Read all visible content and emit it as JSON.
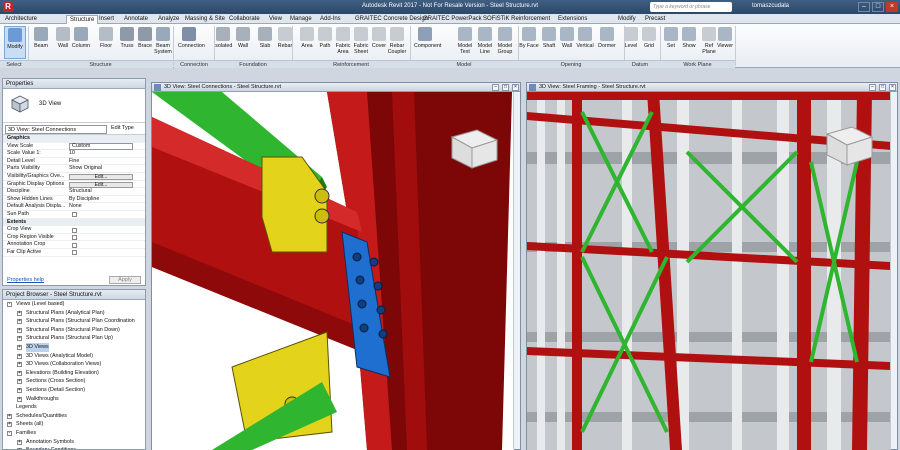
{
  "titlebar": {
    "app_icon": "R",
    "title": "Autodesk Revit 2017  -  Not For Resale Version  -  Steel Structure.rvt",
    "search_placeholder": "Type a keyword or phrase",
    "user": "tomaszcudala"
  },
  "tabs": [
    "Architecture",
    "Structure",
    "Insert",
    "Annotate",
    "Analyze",
    "Massing & Site",
    "Collaborate",
    "View",
    "Manage",
    "Add-Ins",
    "GRAITEC Concrete Design",
    "GRAITEC PowerPack",
    "SOFiSTiK Reinforcement",
    "Extensions",
    "Modify",
    "Precast"
  ],
  "active_tab": "Structure",
  "ribbon": {
    "buttons": [
      "Modify",
      "Beam",
      "Wall",
      "Column",
      "Floor",
      "Truss",
      "Brace",
      "Beam System",
      "Connection",
      "Isolated",
      "Wall",
      "Slab",
      "Rebar",
      "Area",
      "Path",
      "Fabric Area",
      "Fabric Sheet",
      "Cover",
      "Rebar Coupler",
      "Component",
      "Model Text",
      "Model Line",
      "Model Group",
      "By Face",
      "Shaft",
      "Wall",
      "Vertical",
      "Dormer",
      "Level",
      "Grid",
      "Set",
      "Show",
      "Ref Plane",
      "Viewer"
    ],
    "panels": [
      "Select",
      "Structure",
      "Connection",
      "Foundation",
      "Reinforcement",
      "Model",
      "Opening",
      "Datum",
      "Work Plane"
    ]
  },
  "properties": {
    "header": "Properties",
    "type_label": "3D View",
    "view_selector": "3D View: Steel Connections",
    "edit_type": "Edit Type",
    "sections": [
      {
        "title": "Graphics",
        "rows": [
          {
            "k": "View Scale",
            "v": "Custom",
            "kind": "input"
          },
          {
            "k": "Scale Value    1:",
            "v": "10",
            "kind": "text"
          },
          {
            "k": "Detail Level",
            "v": "Fine",
            "kind": "text"
          },
          {
            "k": "Parts Visibility",
            "v": "Show Original",
            "kind": "text"
          },
          {
            "k": "Visibility/Graphics Ove...",
            "v": "Edit...",
            "kind": "button"
          },
          {
            "k": "Graphic Display Options",
            "v": "Edit...",
            "kind": "button"
          },
          {
            "k": "Discipline",
            "v": "Structural",
            "kind": "text"
          },
          {
            "k": "Show Hidden Lines",
            "v": "By Discipline",
            "kind": "text"
          },
          {
            "k": "Default Analysis Displa...",
            "v": "None",
            "kind": "text"
          },
          {
            "k": "Sun Path",
            "v": "",
            "kind": "check"
          }
        ]
      },
      {
        "title": "Extents",
        "rows": [
          {
            "k": "Crop View",
            "v": "",
            "kind": "check"
          },
          {
            "k": "Crop Region Visible",
            "v": "",
            "kind": "check"
          },
          {
            "k": "Annotation Crop",
            "v": "",
            "kind": "check"
          },
          {
            "k": "Far Clip Active",
            "v": "",
            "kind": "check"
          }
        ]
      }
    ],
    "help": "Properties help",
    "apply": "Apply"
  },
  "browser": {
    "header": "Project Browser - Steel Structure.rvt",
    "items": [
      {
        "label": "Views (Level based)",
        "level": 0,
        "box": "-"
      },
      {
        "label": "Structural Plans (Analytical Plan)",
        "level": 1,
        "box": "+"
      },
      {
        "label": "Structural Plans (Structural Plan Coordination",
        "level": 1,
        "box": "+"
      },
      {
        "label": "Structural Plans (Structural Plan Down)",
        "level": 1,
        "box": "+"
      },
      {
        "label": "Structural Plans (Structural Plan Up)",
        "level": 1,
        "box": "+"
      },
      {
        "label": "3D Views",
        "level": 1,
        "box": "+",
        "selected": true
      },
      {
        "label": "3D Views (Analytical Model)",
        "level": 1,
        "box": "+"
      },
      {
        "label": "3D Views (Collaboration Views)",
        "level": 1,
        "box": "+"
      },
      {
        "label": "Elevations (Building Elevation)",
        "level": 1,
        "box": "+"
      },
      {
        "label": "Sections (Cross Section)",
        "level": 1,
        "box": "+"
      },
      {
        "label": "Sections (Detail Section)",
        "level": 1,
        "box": "+"
      },
      {
        "label": "Walkthroughs",
        "level": 1,
        "box": "+"
      },
      {
        "label": "Legends",
        "level": 0,
        "box": ""
      },
      {
        "label": "Schedules/Quantities",
        "level": 0,
        "box": "+"
      },
      {
        "label": "Sheets (all)",
        "level": 0,
        "box": "+"
      },
      {
        "label": "Families",
        "level": 0,
        "box": "-"
      },
      {
        "label": "Annotation Symbols",
        "level": 1,
        "box": "+"
      },
      {
        "label": "Boundary Conditions",
        "level": 1,
        "box": "+"
      }
    ]
  },
  "views": {
    "left_title": "3D View: Steel Connections - Steel Structure.rvt",
    "right_title": "3D View: Steel Framing - Steel Structure.rvt"
  },
  "colors": {
    "steel_red": "#b01010",
    "brace_green": "#2fb52f",
    "plate_yellow": "#e3d31b",
    "plate_blue": "#1f6fd1"
  }
}
